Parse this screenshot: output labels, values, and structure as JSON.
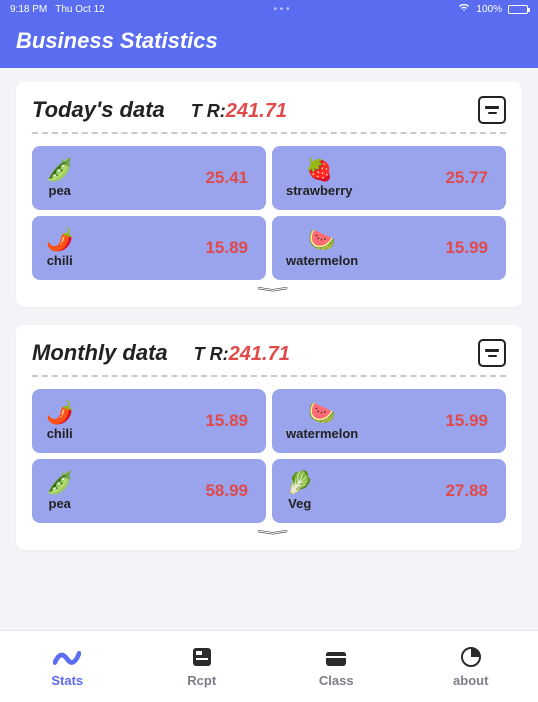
{
  "statusbar": {
    "time": "9:18 PM",
    "date": "Thu Oct 12",
    "battery": "100%"
  },
  "header": {
    "title": "Business Statistics"
  },
  "sections": [
    {
      "title": "Today's data",
      "tr_label": "T R:",
      "tr_value": "241.71",
      "items": [
        {
          "icon": "🫛",
          "name": "pea",
          "value": "25.41"
        },
        {
          "icon": "🍓",
          "name": "strawberry",
          "value": "25.77"
        },
        {
          "icon": "🌶️",
          "name": "chili",
          "value": "15.89"
        },
        {
          "icon": "🍉",
          "name": "watermelon",
          "value": "15.99"
        }
      ]
    },
    {
      "title": "Monthly data",
      "tr_label": "T R:",
      "tr_value": "241.71",
      "items": [
        {
          "icon": "🌶️",
          "name": "chili",
          "value": "15.89"
        },
        {
          "icon": "🍉",
          "name": "watermelon",
          "value": "15.99"
        },
        {
          "icon": "🫛",
          "name": "pea",
          "value": "58.99"
        },
        {
          "icon": "🥬",
          "name": "Veg",
          "value": "27.88"
        }
      ]
    }
  ],
  "tabs": [
    {
      "label": "Stats"
    },
    {
      "label": "Rcpt"
    },
    {
      "label": "Class"
    },
    {
      "label": "about"
    }
  ]
}
